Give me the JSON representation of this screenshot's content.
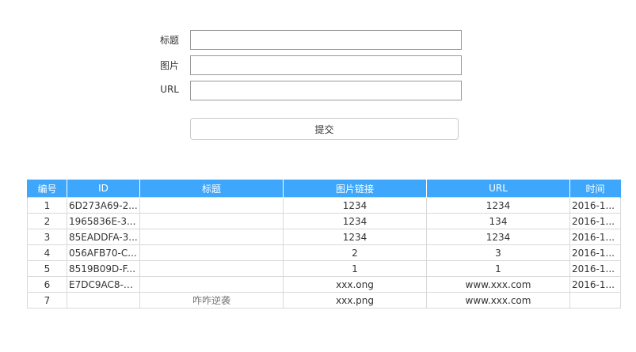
{
  "form": {
    "title_label": "标题",
    "image_label": "图片",
    "url_label": "URL",
    "title_value": "",
    "image_value": "",
    "url_value": "",
    "submit_label": "提交"
  },
  "table": {
    "headers": [
      "编号",
      "ID",
      "标题",
      "图片链接",
      "URL",
      "时间"
    ],
    "rows": [
      {
        "no": "1",
        "id": "6D273A69-2...",
        "title": "",
        "image": "1234",
        "url": "1234",
        "time": "2016-1..."
      },
      {
        "no": "2",
        "id": "1965836E-3...",
        "title": "",
        "image": "1234",
        "url": "134",
        "time": "2016-1..."
      },
      {
        "no": "3",
        "id": "85EADDFA-3...",
        "title": "",
        "image": "1234",
        "url": "1234",
        "time": "2016-1..."
      },
      {
        "no": "4",
        "id": "056AFB70-C...",
        "title": "",
        "image": "2",
        "url": "3",
        "time": "2016-1..."
      },
      {
        "no": "5",
        "id": "8519B09D-F...",
        "title": "",
        "image": "1",
        "url": "1",
        "time": "2016-1..."
      },
      {
        "no": "6",
        "id": "E7DC9AC8-9...",
        "title": "",
        "image": "xxx.ong",
        "url": "www.xxx.com",
        "time": "2016-1..."
      },
      {
        "no": "7",
        "id": "",
        "title": "咋咋逆袭",
        "image": "xxx.png",
        "url": "www.xxx.com",
        "time": ""
      }
    ]
  },
  "colors": {
    "header_bg": "#3fa7fb",
    "header_text": "#ffffff",
    "border": "#d9d9d9"
  }
}
